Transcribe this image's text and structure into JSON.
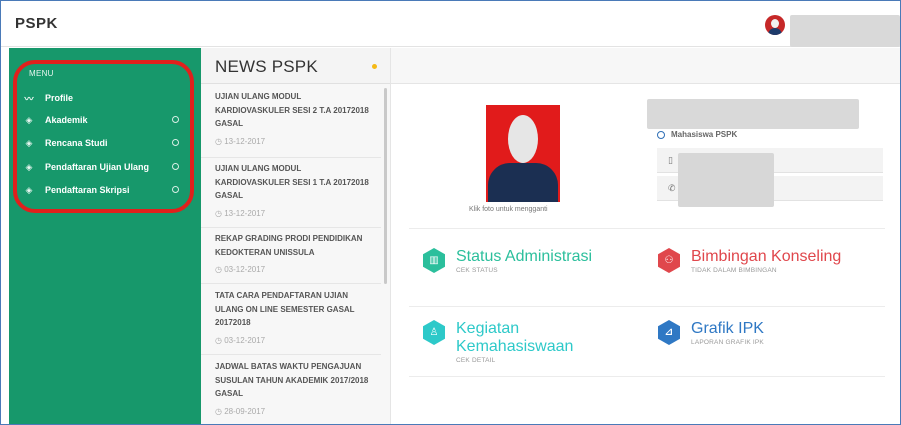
{
  "app": {
    "title": "PSPK"
  },
  "sidebar": {
    "menu_heading": "MENU",
    "items": [
      {
        "label": "Profile",
        "icon": "pulse-icon",
        "has_arrow": false
      },
      {
        "label": "Akademik",
        "icon": "layers-icon",
        "has_arrow": true
      },
      {
        "label": "Rencana Studi",
        "icon": "layers-icon",
        "has_arrow": true
      },
      {
        "label": "Pendaftaran Ujian Ulang",
        "icon": "layers-icon",
        "has_arrow": true
      },
      {
        "label": "Pendaftaran Skripsi",
        "icon": "layers-icon",
        "has_arrow": true
      }
    ]
  },
  "news": {
    "title": "NEWS PSPK",
    "items": [
      {
        "title": "UJIAN ULANG MODUL KARDIOVASKULER SESI 2 T.A 20172018 GASAL",
        "date": "13-12-2017"
      },
      {
        "title": "UJIAN ULANG MODUL KARDIOVASKULER SESI 1 T.A 20172018 GASAL",
        "date": "13-12-2017"
      },
      {
        "title": "REKAP GRADING PRODI PENDIDIKAN KEDOKTERAN UNISSULA",
        "date": "03-12-2017"
      },
      {
        "title": "TATA CARA PENDAFTARAN UJIAN ULANG ON LINE SEMESTER GASAL 20172018",
        "date": "03-12-2017"
      },
      {
        "title": "JADWAL BATAS WAKTU PENGAJUAN SUSULAN TAHUN AKADEMIK 2017/2018 GASAL",
        "date": "28-09-2017"
      }
    ]
  },
  "profile": {
    "photo_hint": "Klik foto untuk mengganti",
    "role": "Mahasiswa PSPK"
  },
  "tiles": [
    {
      "title": "Status Administrasi",
      "sub": "CEK STATUS",
      "color": "#2bbf9c",
      "title_color": "#2bbf9c",
      "icon": "book-icon"
    },
    {
      "title": "Bimbingan Konseling",
      "sub": "TIDAK DALAM BIMBINGAN",
      "color": "#e0474c",
      "title_color": "#e0474c",
      "icon": "users-icon"
    },
    {
      "title": "Kegiatan Kemahasiswaan",
      "sub": "CEK DETAIL",
      "color": "#2dc9c9",
      "title_color": "#2dc9c9",
      "icon": "person-icon"
    },
    {
      "title": "Grafik IPK",
      "sub": "LAPORAN GRAFIK IPK",
      "color": "#2f78c4",
      "title_color": "#2f78c4",
      "icon": "chart-icon"
    }
  ],
  "colors": {
    "sidebar": "#17986b",
    "highlight": "#e0201c",
    "accent_dot": "#f5b915"
  }
}
